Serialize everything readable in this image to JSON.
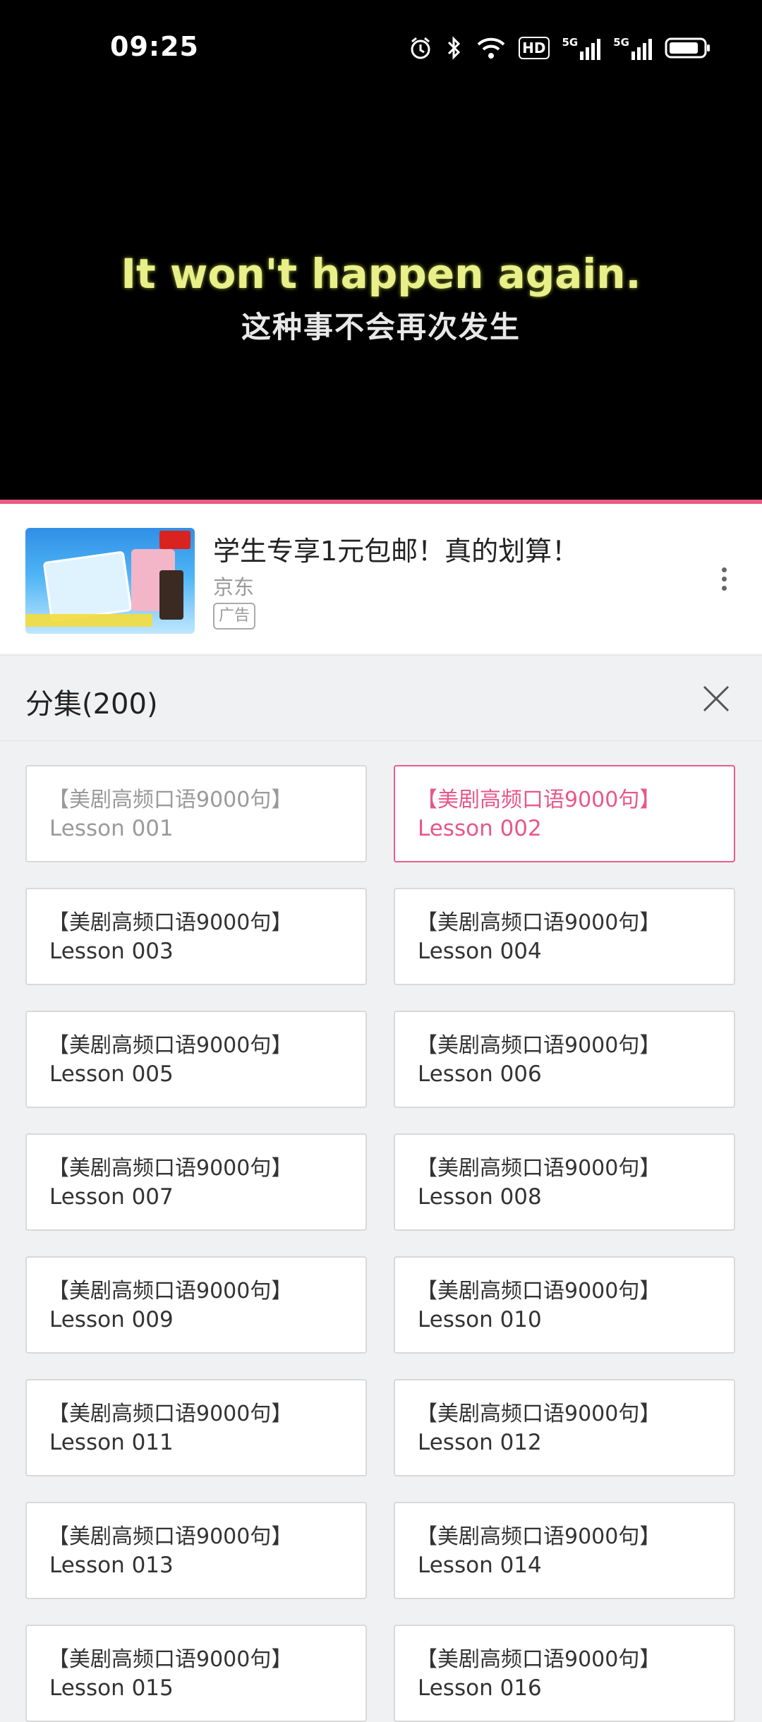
{
  "status_bar": {
    "time": "09:25",
    "icons": [
      "alarm-icon",
      "bluetooth-icon",
      "wifi-icon",
      "hd-icon",
      "signal-5g-icon",
      "signal-5g-icon",
      "battery-icon"
    ],
    "hd_label": "HD",
    "network_label": "5G"
  },
  "video": {
    "subtitle_en": "It won't happen again.",
    "subtitle_zh": "这种事不会再次发生",
    "progress_color": "#eb5a85"
  },
  "ad": {
    "title": "学生专享1元包邮！真的划算！",
    "source": "京东",
    "badge": "广告",
    "thumbnail_icon": "ad-thumbnail-image",
    "menu_icon": "more-vertical-icon"
  },
  "episodes": {
    "header": "分集(200)",
    "close_icon": "close-icon",
    "accent_color": "#e8578a",
    "items": [
      {
        "line1": "【美剧高频口语9000句】",
        "line2": "Lesson 001",
        "state": "watched"
      },
      {
        "line1": "【美剧高频口语9000句】",
        "line2": "Lesson 002",
        "state": "active"
      },
      {
        "line1": "【美剧高频口语9000句】",
        "line2": "Lesson 003",
        "state": "normal"
      },
      {
        "line1": "【美剧高频口语9000句】",
        "line2": "Lesson 004",
        "state": "normal"
      },
      {
        "line1": "【美剧高频口语9000句】",
        "line2": "Lesson 005",
        "state": "normal"
      },
      {
        "line1": "【美剧高频口语9000句】",
        "line2": "Lesson 006",
        "state": "normal"
      },
      {
        "line1": "【美剧高频口语9000句】",
        "line2": "Lesson 007",
        "state": "normal"
      },
      {
        "line1": "【美剧高频口语9000句】",
        "line2": "Lesson 008",
        "state": "normal"
      },
      {
        "line1": "【美剧高频口语9000句】",
        "line2": "Lesson 009",
        "state": "normal"
      },
      {
        "line1": "【美剧高频口语9000句】",
        "line2": "Lesson 010",
        "state": "normal"
      },
      {
        "line1": "【美剧高频口语9000句】",
        "line2": "Lesson 011",
        "state": "normal"
      },
      {
        "line1": "【美剧高频口语9000句】",
        "line2": "Lesson 012",
        "state": "normal"
      },
      {
        "line1": "【美剧高频口语9000句】",
        "line2": "Lesson 013",
        "state": "normal"
      },
      {
        "line1": "【美剧高频口语9000句】",
        "line2": "Lesson 014",
        "state": "normal"
      },
      {
        "line1": "【美剧高频口语9000句】",
        "line2": "Lesson 015",
        "state": "normal"
      },
      {
        "line1": "【美剧高频口语9000句】",
        "line2": "Lesson 016",
        "state": "normal"
      }
    ]
  }
}
